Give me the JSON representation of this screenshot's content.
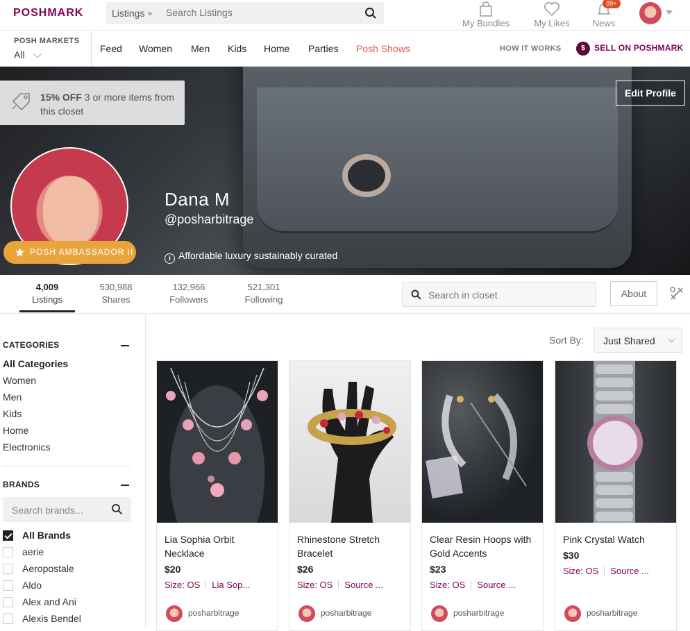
{
  "header": {
    "logo": "POSHMARK",
    "search_category": "Listings",
    "search_placeholder": "Search Listings",
    "nav": [
      {
        "label": "My Bundles",
        "icon": "bag-icon"
      },
      {
        "label": "My Likes",
        "icon": "heart-icon"
      },
      {
        "label": "News",
        "icon": "bell-icon",
        "badge": "99+"
      }
    ]
  },
  "subnav": {
    "markets_label": "POSH MARKETS",
    "markets_value": "All",
    "links": [
      "Feed",
      "Women",
      "Men",
      "Kids",
      "Home",
      "Parties",
      "Posh Shows"
    ],
    "how_it_works": "HOW IT WORKS",
    "sell": "SELL ON POSHMARK"
  },
  "banner": {
    "promo_bold": "15% OFF",
    "promo_text": " 3 or more items from this closet",
    "edit_profile": "Edit Profile",
    "ambassador": "POSH AMBASSADOR II",
    "name": "Dana M",
    "handle": "@posharbitrage",
    "tagline": "Affordable luxury sustainably curated"
  },
  "stats": [
    {
      "value": "4,009",
      "label": "Listings"
    },
    {
      "value": "530,988",
      "label": "Shares"
    },
    {
      "value": "132,966",
      "label": "Followers"
    },
    {
      "value": "521,301",
      "label": "Following"
    }
  ],
  "closet_search_placeholder": "Search in closet",
  "about": "About",
  "sidebar": {
    "categories_title": "CATEGORIES",
    "categories": [
      "All Categories",
      "Women",
      "Men",
      "Kids",
      "Home",
      "Electronics"
    ],
    "brands_title": "BRANDS",
    "brands_placeholder": "Search brands...",
    "brands": [
      "All Brands",
      "aerie",
      "Aeropostale",
      "Aldo",
      "Alex and Ani",
      "Alexis Bendel"
    ]
  },
  "sort": {
    "label": "Sort By:",
    "value": "Just Shared"
  },
  "listings": [
    {
      "title": "Lia Sophia Orbit Necklace",
      "price": "$20",
      "size": "Size: OS",
      "brand": "Lia Sop...",
      "seller": "posharbitrage"
    },
    {
      "title": "Rhinestone Stretch Bracelet",
      "price": "$26",
      "size": "Size: OS",
      "brand": "Source ...",
      "seller": "posharbitrage"
    },
    {
      "title": "Clear Resin Hoops with Gold Accents",
      "price": "$23",
      "size": "Size: OS",
      "brand": "Source ...",
      "seller": "posharbitrage"
    },
    {
      "title": "Pink Crystal Watch",
      "price": "$30",
      "size": "Size: OS",
      "brand": "Source ...",
      "seller": "posharbitrage"
    }
  ]
}
